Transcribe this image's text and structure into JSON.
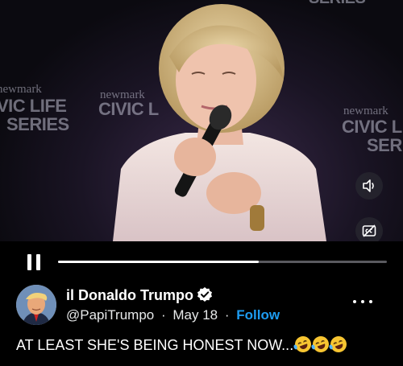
{
  "video": {
    "backdrop": {
      "top_banner": "SERIES",
      "left_brand": "newmark",
      "left_title_1": "VIC LIFE",
      "left_title_2": "SERIES",
      "center_brand": "newmark",
      "center_title": "CIVIC L",
      "right_brand": "newmark",
      "right_title_1": "CIVIC L",
      "right_title_2": "SER"
    },
    "volume_icon": "speaker-icon",
    "captions_icon": "closed-captions-icon"
  },
  "player": {
    "state": "playing",
    "pause_icon": "pause-icon",
    "progress_fraction": 0.61
  },
  "tweet": {
    "display_name": "il Donaldo Trumpo",
    "verified_icon": "verified-badge-icon",
    "handle": "@PapiTrumpo",
    "separator": "·",
    "date": "May 18",
    "follow_label": "Follow",
    "text": "AT LEAST SHE'S BEING HONEST NOW...",
    "emoji_count_icon": "rolling-on-floor-laughing-emoji",
    "accent_color": "#1d9bf0"
  }
}
